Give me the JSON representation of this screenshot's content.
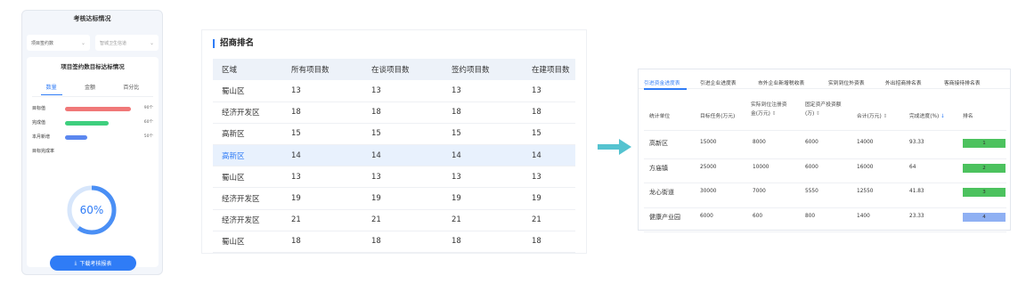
{
  "phone": {
    "title": "考核达标情况",
    "select_left": "项目签约数",
    "select_right": "智城卫生信道",
    "card_title": "项目签约数目标达标情况",
    "tabs": [
      "数量",
      "金额",
      "百分比"
    ],
    "metrics": [
      {
        "label": "目标值",
        "value": "90个",
        "color": "#f07878",
        "fraction": 0.9
      },
      {
        "label": "完成值",
        "value": "60个",
        "color": "#3ecf7e",
        "fraction": 0.6
      },
      {
        "label": "本月新增",
        "value": "50个",
        "color": "#5b87ef",
        "fraction": 0.3
      }
    ],
    "completion_label": "目标完成率",
    "completion_text": "60%",
    "completion_fraction": 0.6,
    "download_label": "下载考核报表",
    "accent": "#2f7cf6"
  },
  "ranking": {
    "title": "招商排名",
    "headers": [
      "区域",
      "所有项目数",
      "在谈项目数",
      "签约项目数",
      "在建项目数"
    ],
    "rows": [
      [
        "蜀山区",
        "13",
        "13",
        "13",
        "13"
      ],
      [
        "经济开发区",
        "18",
        "18",
        "18",
        "18"
      ],
      [
        "高新区",
        "15",
        "15",
        "15",
        "15"
      ],
      [
        "高新区",
        "14",
        "14",
        "14",
        "14"
      ],
      [
        "蜀山区",
        "13",
        "13",
        "13",
        "13"
      ],
      [
        "经济开发区",
        "19",
        "19",
        "19",
        "19"
      ],
      [
        "经济开发区",
        "21",
        "21",
        "21",
        "21"
      ],
      [
        "蜀山区",
        "18",
        "18",
        "18",
        "18"
      ]
    ],
    "highlight_row": 3
  },
  "report": {
    "tabs": [
      "引进资金进度表",
      "引进企业进度表",
      "市外企业新增税收表",
      "实到到位外资表",
      "外出招商排名表",
      "客商接待排名表"
    ],
    "headers": {
      "unit": "统计单位",
      "target": "目标任务(万元)",
      "registered_1": "实际到位注册资",
      "registered_2": "金(万元)",
      "fixed_1": "固定资产投资额",
      "fixed_2": "(万)",
      "total": "合计(万元)",
      "progress": "完成进度(%)",
      "rank": "排名"
    },
    "rows": [
      {
        "unit": "高新区",
        "target": "15000",
        "registered": "8000",
        "fixed": "6000",
        "total": "14000",
        "progress": "93.33",
        "rank": "1",
        "color": "#4cc25e"
      },
      {
        "unit": "方庙镇",
        "target": "25000",
        "registered": "10000",
        "fixed": "6000",
        "total": "16000",
        "progress": "64",
        "rank": "2",
        "color": "#4cc25e"
      },
      {
        "unit": "龙心街道",
        "target": "30000",
        "registered": "7000",
        "fixed": "5550",
        "total": "12550",
        "progress": "41.83",
        "rank": "3",
        "color": "#4cc25e"
      },
      {
        "unit": "健康产业园",
        "target": "6000",
        "registered": "600",
        "fixed": "800",
        "total": "1400",
        "progress": "23.33",
        "rank": "4",
        "color": "#8fb0f3"
      }
    ]
  }
}
